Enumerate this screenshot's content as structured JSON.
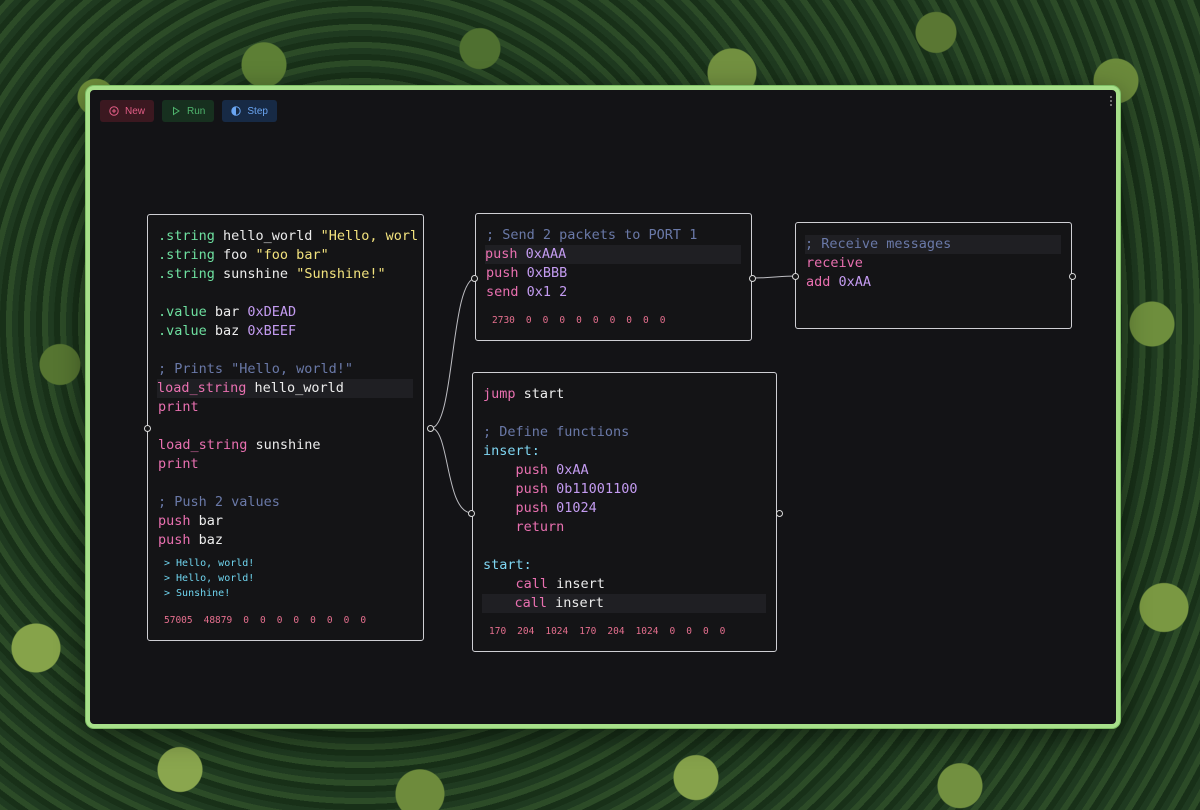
{
  "toolbar": {
    "new_label": "New",
    "run_label": "Run",
    "step_label": "Step"
  },
  "nodes": [
    {
      "id": "main",
      "lines": [
        [
          {
            "t": ".string",
            "c": "kw-dir"
          },
          {
            "t": " hello_world ",
            "c": "ident"
          },
          {
            "t": "\"Hello, worl",
            "c": "str"
          }
        ],
        [
          {
            "t": ".string",
            "c": "kw-dir"
          },
          {
            "t": " foo ",
            "c": "ident"
          },
          {
            "t": "\"foo bar\"",
            "c": "str"
          }
        ],
        [
          {
            "t": ".string",
            "c": "kw-dir"
          },
          {
            "t": " sunshine ",
            "c": "ident"
          },
          {
            "t": "\"Sunshine!\"",
            "c": "str"
          }
        ],
        [],
        [
          {
            "t": ".value",
            "c": "kw-dir"
          },
          {
            "t": " bar ",
            "c": "ident"
          },
          {
            "t": "0xDEAD",
            "c": "num"
          }
        ],
        [
          {
            "t": ".value",
            "c": "kw-dir"
          },
          {
            "t": " baz ",
            "c": "ident"
          },
          {
            "t": "0xBEEF",
            "c": "num"
          }
        ],
        [],
        [
          {
            "t": "; Prints \"Hello, world!\"",
            "c": "cmt"
          }
        ],
        [
          {
            "t": "load_string",
            "c": "kw-op"
          },
          {
            "t": " hello_world",
            "c": "ident"
          }
        ],
        [
          {
            "t": "print",
            "c": "kw-op"
          }
        ],
        [],
        [
          {
            "t": "load_string",
            "c": "kw-op"
          },
          {
            "t": " sunshine",
            "c": "ident"
          }
        ],
        [
          {
            "t": "print",
            "c": "kw-op"
          }
        ],
        [],
        [
          {
            "t": "; Push 2 values",
            "c": "cmt"
          }
        ],
        [
          {
            "t": "push",
            "c": "kw-op"
          },
          {
            "t": " bar",
            "c": "ident"
          }
        ],
        [
          {
            "t": "push",
            "c": "kw-op"
          },
          {
            "t": " baz",
            "c": "ident"
          }
        ]
      ],
      "highlight": 8,
      "output": [
        "> Hello, world!",
        "> Hello, world!",
        "> Sunshine!"
      ],
      "stack": [
        "57005",
        "48879",
        "0",
        "0",
        "0",
        "0",
        "0",
        "0",
        "0",
        "0"
      ]
    },
    {
      "id": "send",
      "lines": [
        [
          {
            "t": "; Send 2 packets to PORT 1",
            "c": "cmt"
          }
        ],
        [
          {
            "t": "push",
            "c": "kw-op"
          },
          {
            "t": " ",
            "c": "ident"
          },
          {
            "t": "0xAAA",
            "c": "num"
          }
        ],
        [
          {
            "t": "push",
            "c": "kw-op"
          },
          {
            "t": " ",
            "c": "ident"
          },
          {
            "t": "0xBBB",
            "c": "num"
          }
        ],
        [
          {
            "t": "send",
            "c": "kw-op"
          },
          {
            "t": " ",
            "c": "ident"
          },
          {
            "t": "0x1 2",
            "c": "num"
          }
        ]
      ],
      "highlight": 1,
      "output": [],
      "stack": [
        "2730",
        "0",
        "0",
        "0",
        "0",
        "0",
        "0",
        "0",
        "0",
        "0"
      ]
    },
    {
      "id": "receive",
      "lines": [
        [
          {
            "t": "; Receive messages",
            "c": "cmt"
          }
        ],
        [
          {
            "t": "receive",
            "c": "kw-op"
          }
        ],
        [
          {
            "t": "add",
            "c": "kw-op"
          },
          {
            "t": " ",
            "c": "ident"
          },
          {
            "t": "0xAA",
            "c": "num"
          }
        ]
      ],
      "highlight": 0,
      "output": [],
      "stack": []
    },
    {
      "id": "functions",
      "lines": [
        [
          {
            "t": "jump",
            "c": "kw-op"
          },
          {
            "t": " start",
            "c": "ident"
          }
        ],
        [],
        [
          {
            "t": "; Define functions",
            "c": "cmt"
          }
        ],
        [
          {
            "t": "insert:",
            "c": "lbl"
          }
        ],
        [
          {
            "t": "    push",
            "c": "kw-op"
          },
          {
            "t": " ",
            "c": "ident"
          },
          {
            "t": "0xAA",
            "c": "num"
          }
        ],
        [
          {
            "t": "    push",
            "c": "kw-op"
          },
          {
            "t": " ",
            "c": "ident"
          },
          {
            "t": "0b11001100",
            "c": "num"
          }
        ],
        [
          {
            "t": "    push",
            "c": "kw-op"
          },
          {
            "t": " ",
            "c": "ident"
          },
          {
            "t": "01024",
            "c": "num"
          }
        ],
        [
          {
            "t": "    return",
            "c": "kw-op"
          }
        ],
        [],
        [
          {
            "t": "start:",
            "c": "lbl"
          }
        ],
        [
          {
            "t": "    call",
            "c": "kw-op"
          },
          {
            "t": " insert",
            "c": "ident"
          }
        ],
        [
          {
            "t": "    call",
            "c": "kw-op"
          },
          {
            "t": " insert",
            "c": "ident"
          }
        ]
      ],
      "highlight": 11,
      "output": [],
      "stack": [
        "170",
        "204",
        "1024",
        "170",
        "204",
        "1024",
        "0",
        "0",
        "0",
        "0"
      ]
    }
  ]
}
